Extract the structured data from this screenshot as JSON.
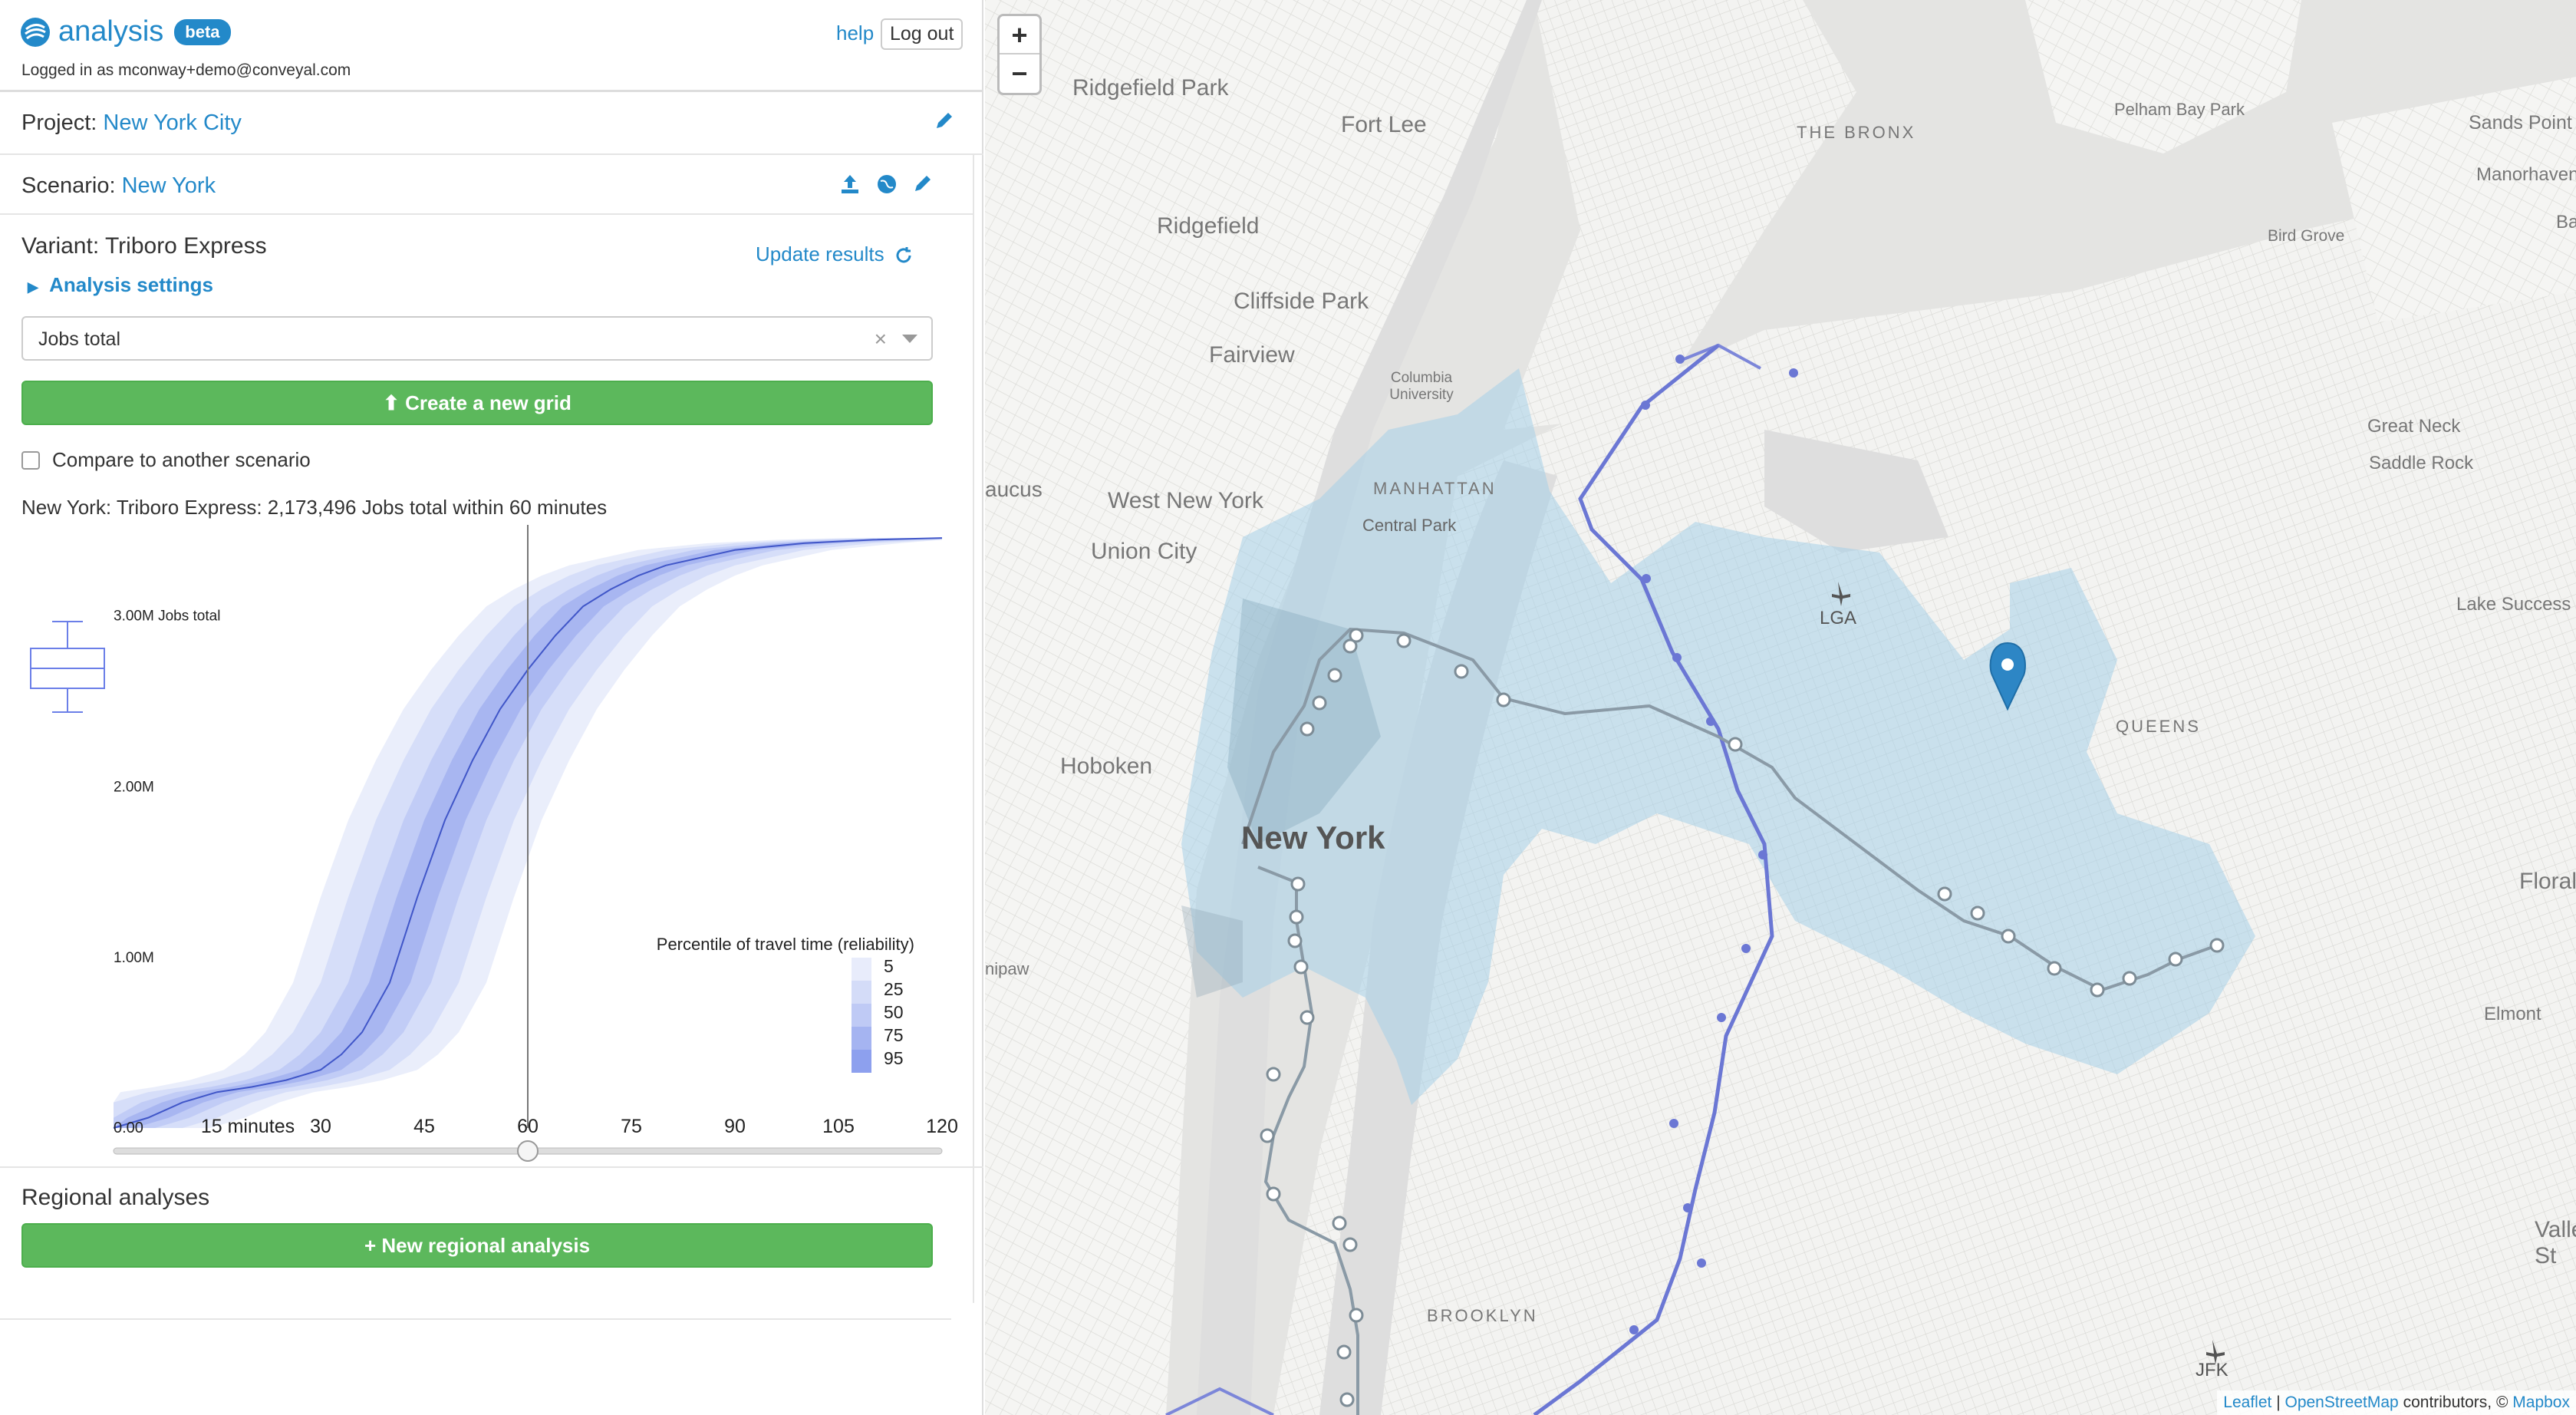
{
  "header": {
    "app_name": "analysis",
    "badge": "beta",
    "logged_in": "Logged in as mconway+demo@conveyal.com",
    "help": "help",
    "logout": "Log out"
  },
  "project": {
    "label": "Project:",
    "name": "New York City"
  },
  "scenario": {
    "label": "Scenario:",
    "name": "New York"
  },
  "variant": {
    "label": "Variant: Triboro Express",
    "update": "Update results",
    "settings": "Analysis settings"
  },
  "grid_select": {
    "value": "Jobs total",
    "create_button": "Create a new grid"
  },
  "compare": {
    "label": "Compare to another scenario"
  },
  "result_text": "New York: Triboro Express: 2,173,496 Jobs total within 60 minutes",
  "chart_data": {
    "type": "area",
    "x_ticks": [
      "0.00",
      "15 minutes",
      "30",
      "45",
      "60",
      "75",
      "90",
      "105",
      "120"
    ],
    "y_ticks": [
      "3.00M Jobs total",
      "2.00M",
      "1.00M"
    ],
    "xlim": [
      0,
      120
    ],
    "ylim": [
      0,
      3500000
    ],
    "cutoff_minutes": 60,
    "legend_title": "Percentile of travel time (reliability)",
    "legend_items": [
      "5",
      "25",
      "50",
      "75",
      "95"
    ],
    "legend_colors": [
      "#e8ecfb",
      "#d4dcf8",
      "#bfcaf5",
      "#a5b4f1",
      "#8da0ee"
    ],
    "median_series": {
      "x": [
        0,
        5,
        10,
        15,
        20,
        25,
        30,
        33,
        36,
        40,
        44,
        48,
        52,
        56,
        60,
        64,
        68,
        72,
        76,
        80,
        90,
        100,
        110,
        120
      ],
      "y": [
        0,
        60000,
        150000,
        210000,
        240000,
        280000,
        340000,
        430000,
        560000,
        850000,
        1350000,
        1800000,
        2150000,
        2450000,
        2680000,
        2880000,
        3050000,
        3150000,
        3230000,
        3290000,
        3380000,
        3420000,
        3440000,
        3450000
      ]
    }
  },
  "regional": {
    "title": "Regional analyses",
    "button": "New regional analysis"
  },
  "map": {
    "zoom_in": "+",
    "zoom_out": "−",
    "labels": {
      "ridgefield_park": "Ridgefield Park",
      "fort_lee": "Fort Lee",
      "the_bronx": "THE BRONX",
      "pelham_bay_park": "Pelham Bay Park",
      "sands_point": "Sands Point",
      "manorhaven": "Manorhaven",
      "ridgefield": "Ridgefield",
      "cliffside_park": "Cliffside Park",
      "fairview": "Fairview",
      "columbia": "Columbia University",
      "bird_grove": "Bird Grove",
      "great_neck": "Great Neck",
      "saddle_rock": "Saddle Rock",
      "manhattan": "MANHATTAN",
      "central_park": "Central Park",
      "west_new_york": "West New York",
      "union_city": "Union City",
      "secaucus": "aucus",
      "lga": "LGA",
      "lake_success": "Lake Success",
      "hoboken": "Hoboken",
      "queens": "QUEENS",
      "new_york": "New York",
      "floral": "Floral",
      "nipaw": "nipaw",
      "elmont": "Elmont",
      "valley": "Valley St",
      "brooklyn": "BROOKLYN",
      "jfk": "JFK",
      "ba": "Ba"
    },
    "attribution": {
      "leaflet": "Leaflet",
      "osm": "OpenStreetMap",
      "contrib": " contributors, © ",
      "mapbox": "Mapbox"
    }
  }
}
